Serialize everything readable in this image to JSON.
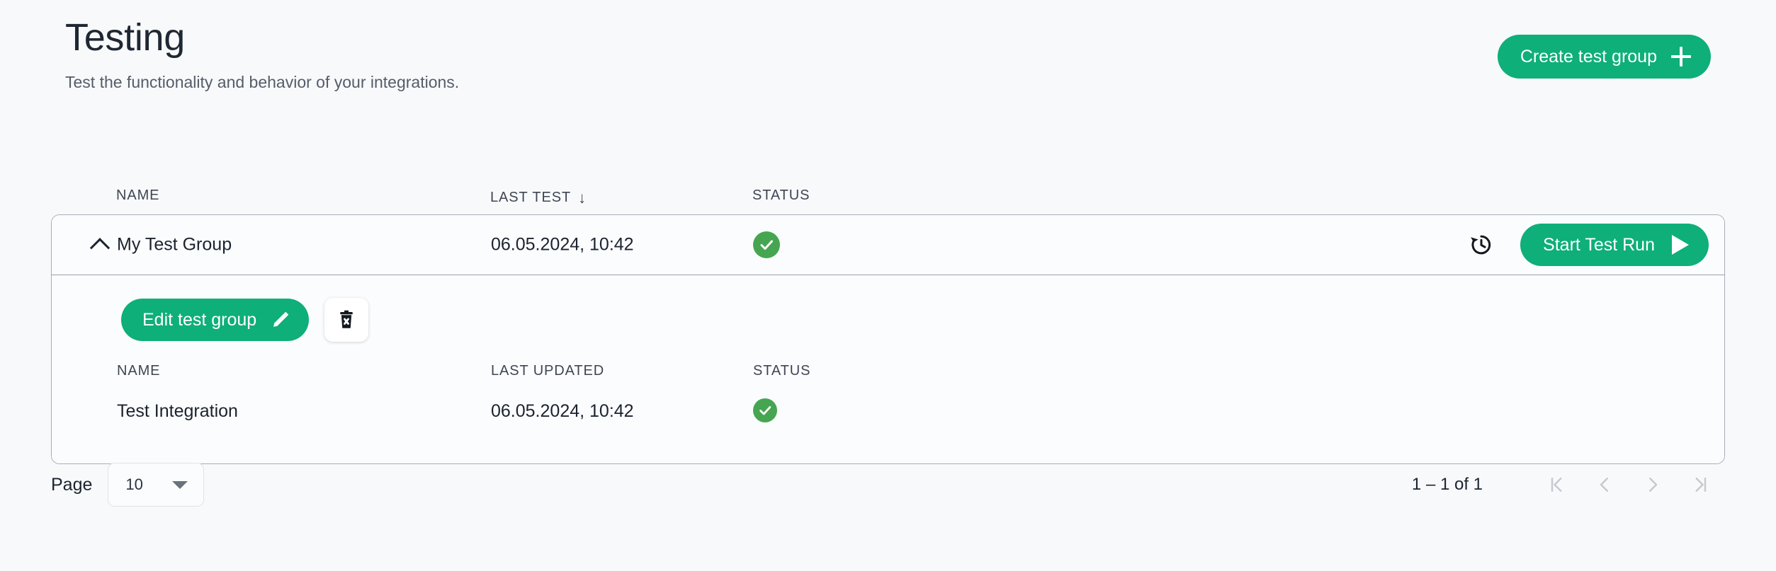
{
  "header": {
    "title": "Testing",
    "subtitle": "Test the functionality and behavior of your integrations.",
    "create_button": "Create test group",
    "create_button_icon": "plus-icon"
  },
  "table": {
    "columns": [
      "NAME",
      "LAST TEST",
      "STATUS"
    ],
    "sort_column": "LAST TEST",
    "sort_direction_icon": "arrow-down-icon",
    "rows": [
      {
        "expanded": true,
        "expand_icon": "chevron-up-icon",
        "name": "My Test Group",
        "last_test": "06.05.2024, 10:42",
        "status_icon": "check-circle-icon",
        "history_icon": "history-icon",
        "start_button": "Start Test Run",
        "start_button_icon": "play-icon",
        "detail": {
          "edit_button": "Edit test group",
          "edit_button_icon": "pencil-icon",
          "delete_button_icon": "trash-delete-icon",
          "columns": [
            "NAME",
            "LAST UPDATED",
            "STATUS"
          ],
          "items": [
            {
              "name": "Test Integration",
              "last_updated": "06.05.2024, 10:42",
              "status_icon": "check-circle-icon"
            }
          ]
        }
      }
    ]
  },
  "pagination": {
    "page_label": "Page",
    "page_size": "10",
    "page_size_caret_icon": "chevron-down-icon",
    "range_text": "1 – 1 of 1",
    "first_icon": "first-page-icon",
    "prev_icon": "previous-page-icon",
    "next_icon": "next-page-icon",
    "last_icon": "last-page-icon"
  },
  "colors": {
    "accent_green": "#0eaf78",
    "status_green": "#46a551",
    "page_background": "#f8f9fb",
    "card_background": "#fbfcfd",
    "card_border": "#a9afb8",
    "text_primary": "#1b2330",
    "text_muted": "#555d69"
  }
}
